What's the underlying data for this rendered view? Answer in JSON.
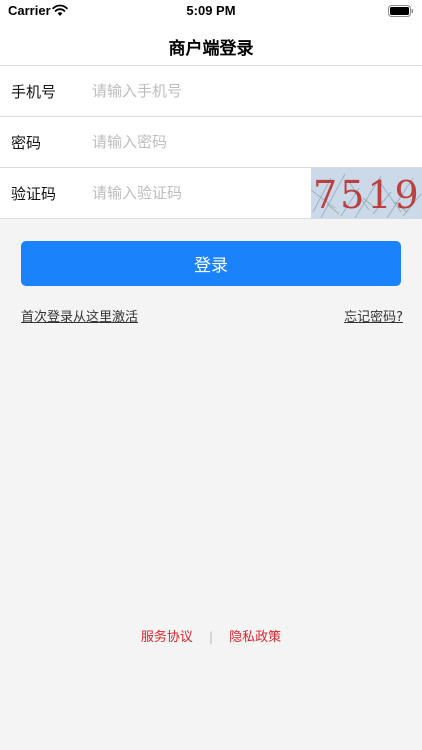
{
  "status_bar": {
    "carrier": "Carrier",
    "time": "5:09 PM",
    "wifi_icon": "wifi-icon",
    "battery_icon": "battery-icon"
  },
  "navbar": {
    "title": "商户端登录"
  },
  "form": {
    "phone": {
      "label": "手机号",
      "placeholder": "请输入手机号",
      "value": ""
    },
    "password": {
      "label": "密码",
      "placeholder": "请输入密码",
      "value": ""
    },
    "captcha": {
      "label": "验证码",
      "placeholder": "请输入验证码",
      "value": "",
      "image_text": "7519"
    }
  },
  "actions": {
    "login_label": "登录",
    "activate_label": "首次登录从这里激活",
    "forgot_label": "忘记密码?"
  },
  "footer": {
    "service_agreement": "服务协议",
    "separator": "|",
    "privacy_policy": "隐私政策"
  },
  "colors": {
    "primary": "#1a82fb",
    "footer_link": "#d7262e",
    "background": "#f4f4f4"
  }
}
